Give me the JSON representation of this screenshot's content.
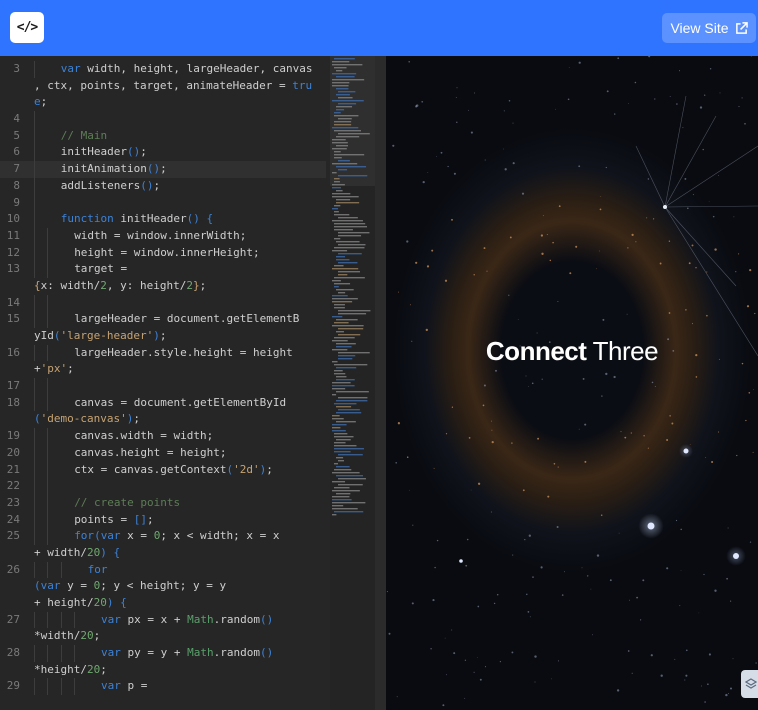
{
  "topbar": {
    "code_toggle_label": "</>",
    "view_site_label": "View Site",
    "accent": "#2f74ff"
  },
  "editor": {
    "active_line": 7,
    "lines": [
      {
        "n": "3",
        "depth": 1,
        "tokens": [
          [
            "kw",
            "var"
          ],
          [
            "p",
            " width, height, largeHeader, canvas"
          ]
        ]
      },
      {
        "n": "",
        "depth": 0,
        "tokens": [
          [
            "p",
            ", ctx, points, target, animateHeader = "
          ],
          [
            "kw",
            "tru"
          ]
        ]
      },
      {
        "n": "",
        "depth": 0,
        "tokens": [
          [
            "kw",
            "e"
          ],
          [
            "p",
            ";"
          ]
        ]
      },
      {
        "n": "4",
        "depth": 1,
        "tokens": []
      },
      {
        "n": "5",
        "depth": 1,
        "tokens": [
          [
            "cm",
            "// Main"
          ]
        ]
      },
      {
        "n": "6",
        "depth": 1,
        "tokens": [
          [
            "p",
            "initHeader"
          ],
          [
            "kw",
            "()"
          ],
          [
            "p",
            ";"
          ]
        ]
      },
      {
        "n": "7",
        "depth": 1,
        "tokens": [
          [
            "p",
            "initAnimation"
          ],
          [
            "kw",
            "()"
          ],
          [
            "p",
            ";"
          ]
        ]
      },
      {
        "n": "8",
        "depth": 1,
        "tokens": [
          [
            "p",
            "addListeners"
          ],
          [
            "kw",
            "()"
          ],
          [
            "p",
            ";"
          ]
        ]
      },
      {
        "n": "9",
        "depth": 1,
        "tokens": []
      },
      {
        "n": "10",
        "depth": 1,
        "tokens": [
          [
            "kw",
            "function"
          ],
          [
            "p",
            " initHeader"
          ],
          [
            "kw",
            "()"
          ],
          [
            "p",
            " "
          ],
          [
            "kw",
            "{"
          ]
        ]
      },
      {
        "n": "11",
        "depth": 2,
        "tokens": [
          [
            "p",
            "width = window.innerWidth;"
          ]
        ]
      },
      {
        "n": "12",
        "depth": 2,
        "tokens": [
          [
            "p",
            "height = window.innerHeight;"
          ]
        ]
      },
      {
        "n": "13",
        "depth": 2,
        "tokens": [
          [
            "p",
            "target ="
          ]
        ]
      },
      {
        "n": "",
        "depth": 0,
        "tokens": [
          [
            "st",
            "{"
          ],
          [
            "p",
            "x: width/"
          ],
          [
            "nm",
            "2"
          ],
          [
            "p",
            ", y: height/"
          ],
          [
            "nm",
            "2"
          ],
          [
            "st",
            "}"
          ],
          [
            "p",
            ";"
          ]
        ]
      },
      {
        "n": "14",
        "depth": 2,
        "tokens": []
      },
      {
        "n": "15",
        "depth": 2,
        "tokens": [
          [
            "p",
            "largeHeader = document.getElementB"
          ]
        ]
      },
      {
        "n": "",
        "depth": 0,
        "tokens": [
          [
            "p",
            "yId"
          ],
          [
            "kw",
            "("
          ],
          [
            "st",
            "'large-header'"
          ],
          [
            "kw",
            ")"
          ],
          [
            "p",
            ";"
          ]
        ]
      },
      {
        "n": "16",
        "depth": 2,
        "tokens": [
          [
            "p",
            "largeHeader.style.height = height"
          ]
        ]
      },
      {
        "n": "",
        "depth": 0,
        "tokens": [
          [
            "p",
            "+"
          ],
          [
            "st",
            "'px'"
          ],
          [
            "p",
            ";"
          ]
        ]
      },
      {
        "n": "17",
        "depth": 2,
        "tokens": []
      },
      {
        "n": "18",
        "depth": 2,
        "tokens": [
          [
            "p",
            "canvas = document.getElementById"
          ]
        ]
      },
      {
        "n": "",
        "depth": 0,
        "tokens": [
          [
            "kw",
            "("
          ],
          [
            "st",
            "'demo-canvas'"
          ],
          [
            "kw",
            ")"
          ],
          [
            "p",
            ";"
          ]
        ]
      },
      {
        "n": "19",
        "depth": 2,
        "tokens": [
          [
            "p",
            "canvas.width = width;"
          ]
        ]
      },
      {
        "n": "20",
        "depth": 2,
        "tokens": [
          [
            "p",
            "canvas.height = height;"
          ]
        ]
      },
      {
        "n": "21",
        "depth": 2,
        "tokens": [
          [
            "p",
            "ctx = canvas.getContext"
          ],
          [
            "kw",
            "("
          ],
          [
            "st",
            "'2d'"
          ],
          [
            "kw",
            ")"
          ],
          [
            "p",
            ";"
          ]
        ]
      },
      {
        "n": "22",
        "depth": 2,
        "tokens": []
      },
      {
        "n": "23",
        "depth": 2,
        "tokens": [
          [
            "cm",
            "// create points"
          ]
        ]
      },
      {
        "n": "24",
        "depth": 2,
        "tokens": [
          [
            "p",
            "points = "
          ],
          [
            "kw",
            "[]"
          ],
          [
            "p",
            ";"
          ]
        ]
      },
      {
        "n": "25",
        "depth": 2,
        "tokens": [
          [
            "kw",
            "for"
          ],
          [
            "kw",
            "("
          ],
          [
            "kw",
            "var"
          ],
          [
            "p",
            " x = "
          ],
          [
            "nm",
            "0"
          ],
          [
            "p",
            "; x < width; x = x"
          ]
        ]
      },
      {
        "n": "",
        "depth": 0,
        "tokens": [
          [
            "p",
            "+ width/"
          ],
          [
            "nm",
            "20"
          ],
          [
            "kw",
            ")"
          ],
          [
            "p",
            " "
          ],
          [
            "kw",
            "{"
          ]
        ]
      },
      {
        "n": "26",
        "depth": 3,
        "tokens": [
          [
            "kw",
            "for"
          ]
        ]
      },
      {
        "n": "",
        "depth": 0,
        "tokens": [
          [
            "kw",
            "("
          ],
          [
            "kw",
            "var"
          ],
          [
            "p",
            " y = "
          ],
          [
            "nm",
            "0"
          ],
          [
            "p",
            "; y < height; y = y"
          ]
        ]
      },
      {
        "n": "",
        "depth": 0,
        "tokens": [
          [
            "p",
            "+ height/"
          ],
          [
            "nm",
            "20"
          ],
          [
            "kw",
            ")"
          ],
          [
            "p",
            " "
          ],
          [
            "kw",
            "{"
          ]
        ]
      },
      {
        "n": "27",
        "depth": 4,
        "tokens": [
          [
            "kw",
            "var"
          ],
          [
            "p",
            " px = x + "
          ],
          [
            "mt",
            "Math"
          ],
          [
            "p",
            ".random"
          ],
          [
            "kw",
            "()"
          ]
        ]
      },
      {
        "n": "",
        "depth": 0,
        "tokens": [
          [
            "p",
            "*width/"
          ],
          [
            "nm",
            "20"
          ],
          [
            "p",
            ";"
          ]
        ]
      },
      {
        "n": "28",
        "depth": 4,
        "tokens": [
          [
            "kw",
            "var"
          ],
          [
            "p",
            " py = y + "
          ],
          [
            "mt",
            "Math"
          ],
          [
            "p",
            ".random"
          ],
          [
            "kw",
            "()"
          ]
        ]
      },
      {
        "n": "",
        "depth": 0,
        "tokens": [
          [
            "p",
            "*height/"
          ],
          [
            "nm",
            "20"
          ],
          [
            "p",
            ";"
          ]
        ]
      },
      {
        "n": "29",
        "depth": 4,
        "tokens": [
          [
            "kw",
            "var"
          ],
          [
            "p",
            " p ="
          ]
        ]
      }
    ]
  },
  "preview": {
    "title_bold": "Connect",
    "title_light": " Three"
  }
}
